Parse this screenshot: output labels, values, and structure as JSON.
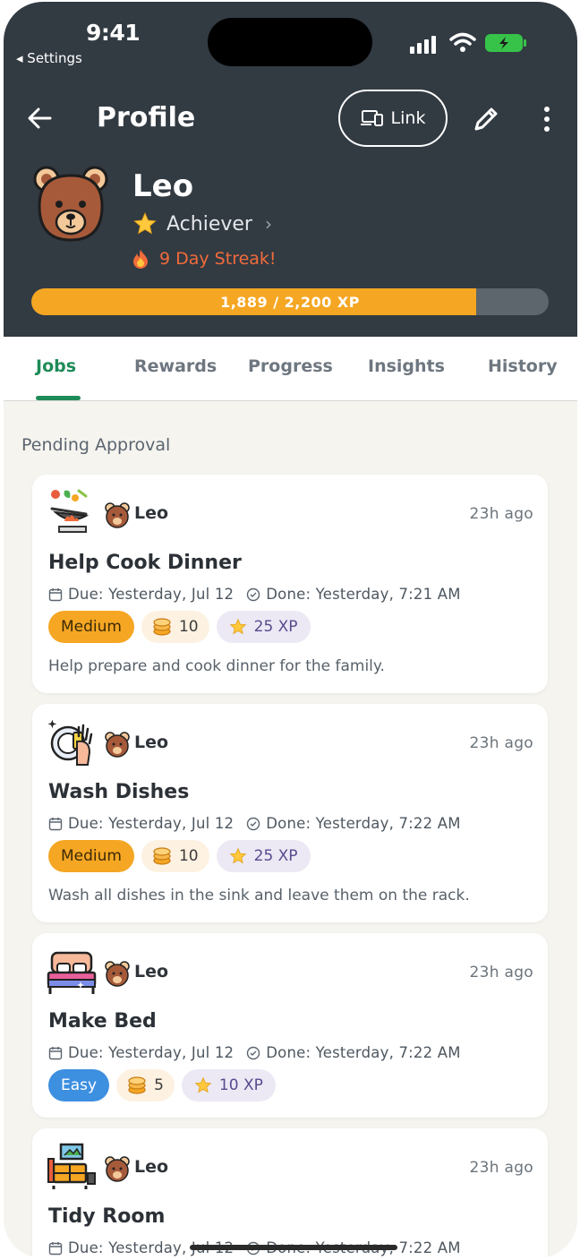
{
  "status_bar": {
    "time": "9:41",
    "back_app": "◂ Settings"
  },
  "nav": {
    "title": "Profile",
    "link_label": "Link"
  },
  "profile": {
    "name": "Leo",
    "rank": "Achiever",
    "streak": "9 Day Streak!",
    "xp_text": "1,889 / 2,200 XP",
    "xp_progress": 0.859
  },
  "tabs": [
    "Jobs",
    "Rewards",
    "Progress",
    "Insights",
    "History"
  ],
  "section_title": "Pending Approval",
  "jobs": [
    {
      "icon": "cooking-icon",
      "kid": "Leo",
      "time": "23h ago",
      "title": "Help Cook Dinner",
      "due": "Due: Yesterday, Jul 12",
      "done": "Done: Yesterday, 7:21 AM",
      "difficulty": "Medium",
      "coins": "10",
      "xp": "25 XP",
      "description": "Help prepare and cook dinner for the family."
    },
    {
      "icon": "wash-dishes-icon",
      "kid": "Leo",
      "time": "23h ago",
      "title": "Wash Dishes",
      "due": "Due: Yesterday, Jul 12",
      "done": "Done: Yesterday, 7:22 AM",
      "difficulty": "Medium",
      "coins": "10",
      "xp": "25 XP",
      "description": "Wash all dishes in the sink and leave them on the rack."
    },
    {
      "icon": "bed-icon",
      "kid": "Leo",
      "time": "23h ago",
      "title": "Make Bed",
      "due": "Due: Yesterday, Jul 12",
      "done": "Done: Yesterday, 7:22 AM",
      "difficulty": "Easy",
      "coins": "5",
      "xp": "10 XP",
      "description": ""
    },
    {
      "icon": "tidy-room-icon",
      "kid": "Leo",
      "time": "23h ago",
      "title": "Tidy Room",
      "due": "Due: Yesterday, Jul 12",
      "done": "Done: Yesterday, 7:22 AM",
      "difficulty": "",
      "coins": "",
      "xp": "",
      "description": ""
    }
  ],
  "colors": {
    "header_bg": "#323a42",
    "accent_green": "#1f8b58",
    "xp_fill": "#f5a623",
    "streak": "#f26b3a",
    "easy": "#3d8fe0",
    "medium": "#f5a623"
  }
}
